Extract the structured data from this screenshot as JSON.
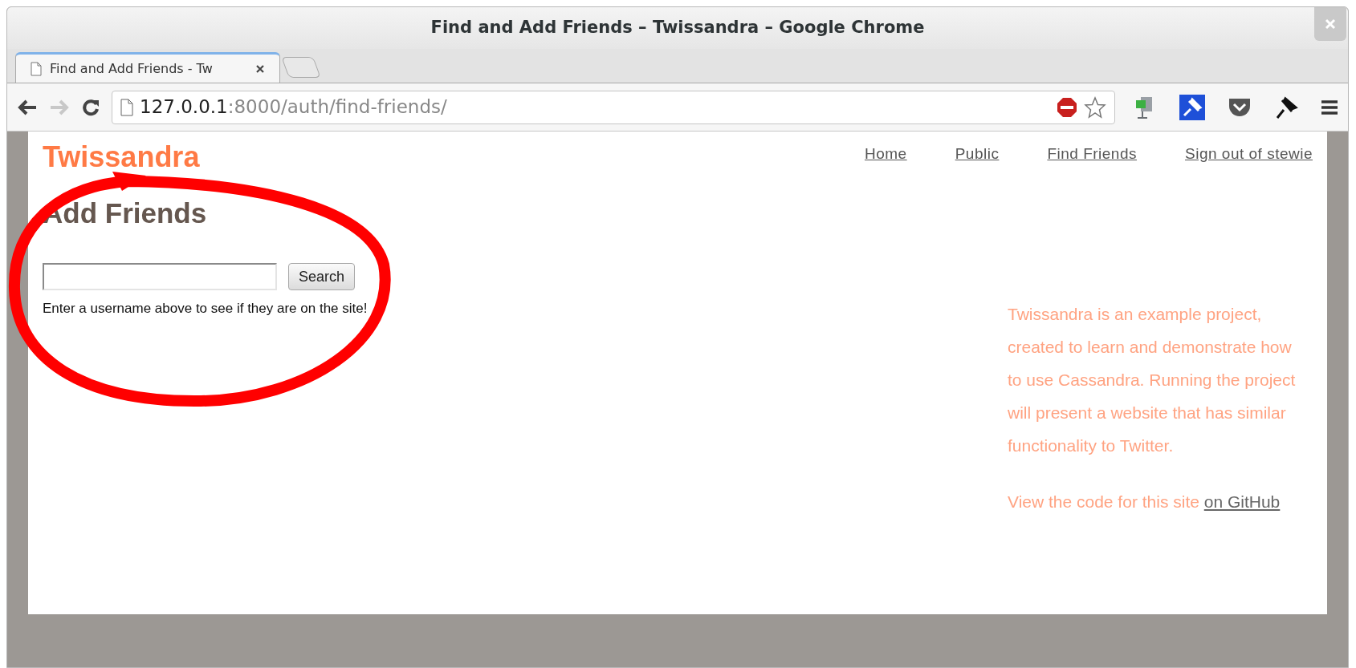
{
  "window": {
    "title": "Find and Add Friends – Twissandra – Google Chrome"
  },
  "tabs": [
    {
      "label": "Find and Add Friends - Tw",
      "selected": true
    }
  ],
  "address_bar": {
    "host": "127.0.0.1",
    "path": ":8000/auth/find-friends/"
  },
  "page": {
    "logo": "Twissandra",
    "nav": [
      "Home",
      "Public",
      "Find Friends",
      "Sign out of stewie"
    ],
    "heading": "Add Friends",
    "search": {
      "button": "Search"
    },
    "hint": "Enter a username above to see if they are on the site!",
    "sidebar": {
      "about": "Twissandra is an example project, created to learn and demonstrate how to use Cassandra. Running the project will present a website that has similar functionality to Twitter.",
      "code_text": "View the code for this site",
      "code_link": "on GitHub"
    }
  }
}
